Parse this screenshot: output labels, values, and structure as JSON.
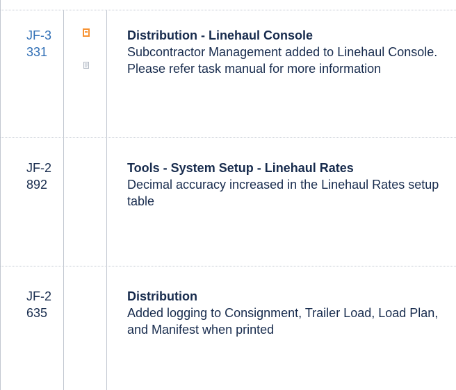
{
  "rows": [
    {
      "key": "JF-3331",
      "title": "Distribution - Linehaul Console",
      "description": "Subcontractor Management added to Linehaul Console.  Please refer task manual for more information",
      "icons": [
        "bookmark-icon",
        "document-icon"
      ],
      "key_color": "#2f6eb5"
    },
    {
      "key": "JF-2892",
      "title": "Tools - System Setup - Linehaul Rates",
      "description": "Decimal accuracy increased in the Linehaul Rates setup table"
    },
    {
      "key": "JF-2635",
      "title": "Distribution",
      "description": "Added logging to Consignment, Trailer Load, Load Plan, and Manifest when printed"
    }
  ],
  "colors": {
    "text": "#172b4d",
    "link": "#2f6eb5",
    "border": "#c1c7d0",
    "icon_orange": "#f79232"
  }
}
